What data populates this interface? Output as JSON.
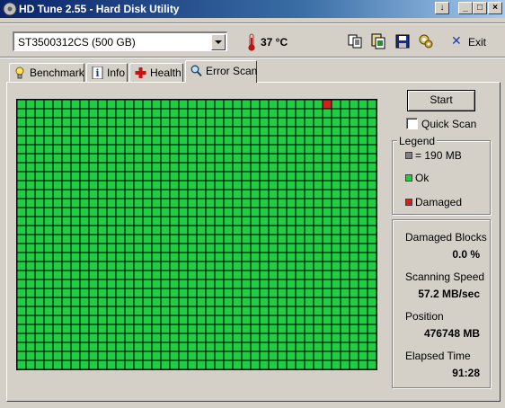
{
  "window": {
    "title": "HD Tune 2.55 - Hard Disk Utility",
    "icon": "hd-tune-app-icon",
    "buttons": {
      "extra": "↓",
      "minimize": "_",
      "maximize": "□",
      "close": "×"
    }
  },
  "toolbar": {
    "drive_selected": "ST3500312CS (500 GB)",
    "temperature": "37 °C",
    "icons": [
      "copy-icon",
      "copy-all-icon",
      "save-icon",
      "options-icon"
    ],
    "exit_label": "Exit"
  },
  "tabs": [
    {
      "label": "Benchmark",
      "icon": "benchmark-icon"
    },
    {
      "label": "Info",
      "icon": "info-icon"
    },
    {
      "label": "Health",
      "icon": "health-icon"
    },
    {
      "label": "Error Scan",
      "icon": "search-icon",
      "active": true
    }
  ],
  "scan": {
    "columns": 40,
    "rows": 30,
    "damaged_blocks_at": [
      {
        "row": 0,
        "col": 34
      }
    ],
    "colors": {
      "ok": "#22cc44",
      "damaged": "#cc2222",
      "block_size": "#808080",
      "gridline": "#000000"
    }
  },
  "controls": {
    "start_label": "Start",
    "quick_scan_label": "Quick Scan",
    "quick_scan_checked": false
  },
  "legend": {
    "title": "Legend",
    "items": [
      {
        "label": "= 190 MB",
        "color": "#808080"
      },
      {
        "label": "Ok",
        "color": "#22cc44"
      },
      {
        "label": "Damaged",
        "color": "#cc2222"
      }
    ]
  },
  "stats": [
    {
      "label": "Damaged Blocks",
      "value": "0.0 %"
    },
    {
      "label": "Scanning Speed",
      "value": "57.2 MB/sec"
    },
    {
      "label": "Position",
      "value": "476748 MB"
    },
    {
      "label": "Elapsed Time",
      "value": "91:28"
    }
  ]
}
